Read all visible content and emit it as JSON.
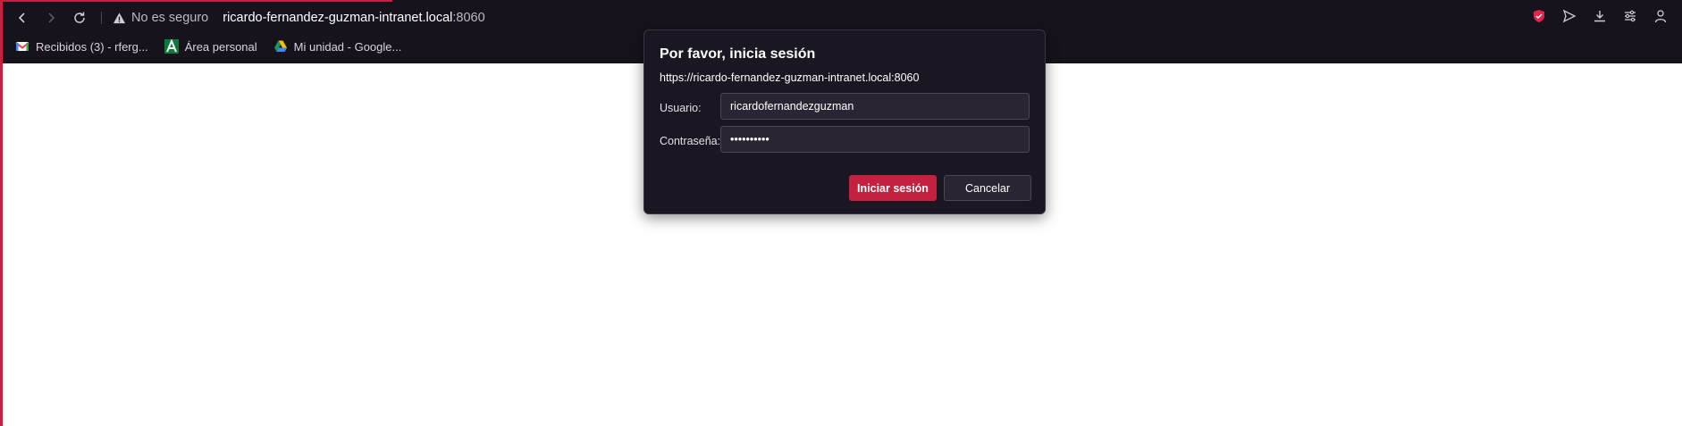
{
  "browser": {
    "security_text": "No es seguro",
    "url_host": "ricardo-fernandez-guzman-intranet.local",
    "url_port": ":8060",
    "bookmarks": [
      {
        "icon": "gmail-icon",
        "label": "Recibidos (3) - rferg..."
      },
      {
        "icon": "andalucia-icon",
        "label": "Área personal"
      },
      {
        "icon": "google-drive-icon",
        "label": "Mi unidad - Google..."
      }
    ],
    "accent_color": "#c4203f"
  },
  "dialog": {
    "title": "Por favor, inicia sesión",
    "origin": "https://ricardo-fernandez-guzman-intranet.local:8060",
    "username_label": "Usuario:",
    "username_value": "ricardofernandezguzman",
    "password_label": "Contraseña:",
    "password_value": "••••••••••",
    "login_button": "Iniciar sesión",
    "cancel_button": "Cancelar"
  }
}
